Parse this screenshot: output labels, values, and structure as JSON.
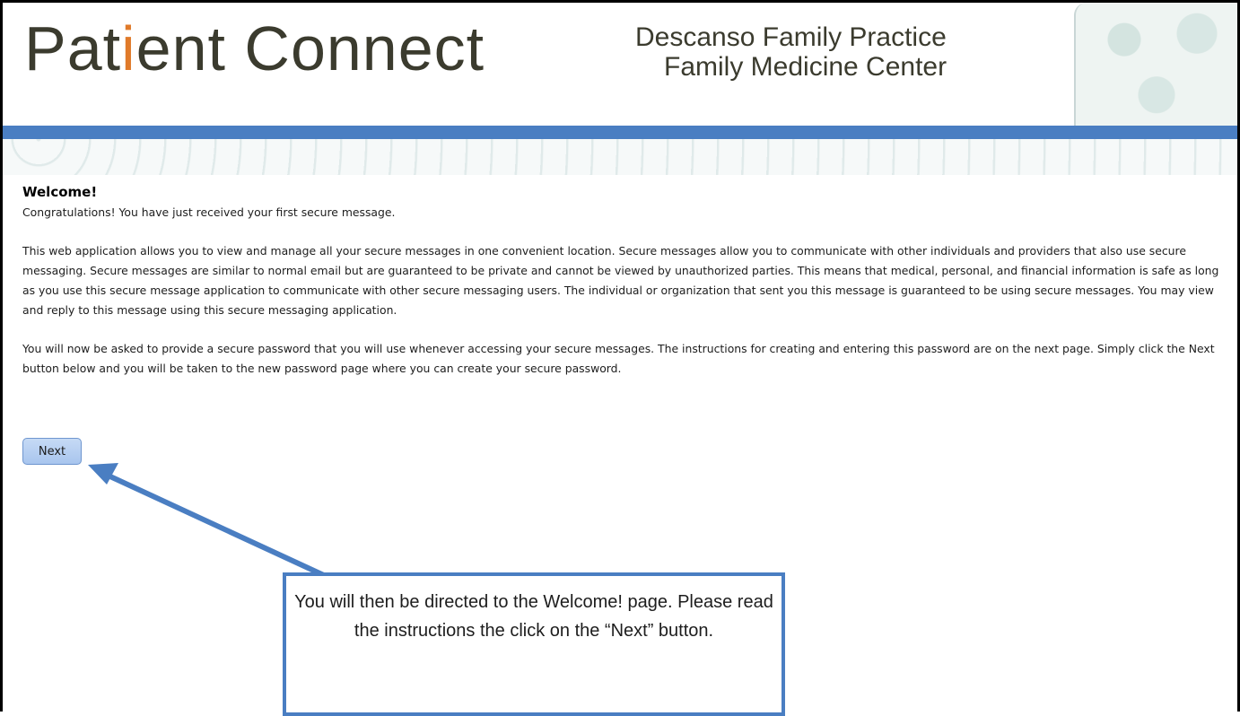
{
  "header": {
    "logo_text_1": "Pat",
    "logo_text_dot": "i",
    "logo_text_2": "ent Connect",
    "practice_line1": "Descanso Family Practice",
    "practice_line2": "Family Medicine Center"
  },
  "main": {
    "title": "Welcome!",
    "intro": "Congratulations! You have just received your first secure message.",
    "paragraph1": "This web application allows you to view and manage all your secure messages in one convenient location. Secure messages allow you to communicate with other individuals and providers that also use secure messaging. Secure messages are similar to normal email but are guaranteed to be private and cannot be viewed by unauthorized parties. This means that medical, personal, and financial information is safe as long as you use this secure message application to communicate with other secure messaging users. The individual or organization that sent you this message is guaranteed to be using secure messages. You may view and reply to this message using this secure messaging application.",
    "paragraph2": "You will now be asked to provide a secure password that you will use whenever accessing your secure messages. The instructions for creating and entering this password are on the next page. Simply click the Next button below and you will be taken to the new password page where you can create your secure password.",
    "next_label": "Next"
  },
  "callout": {
    "text": "You will then be directed to the Welcome! page. Please read the instructions the click on the “Next” button."
  },
  "colors": {
    "accent_blue": "#4a7ec2",
    "button_blue": "#a8c5ee"
  }
}
